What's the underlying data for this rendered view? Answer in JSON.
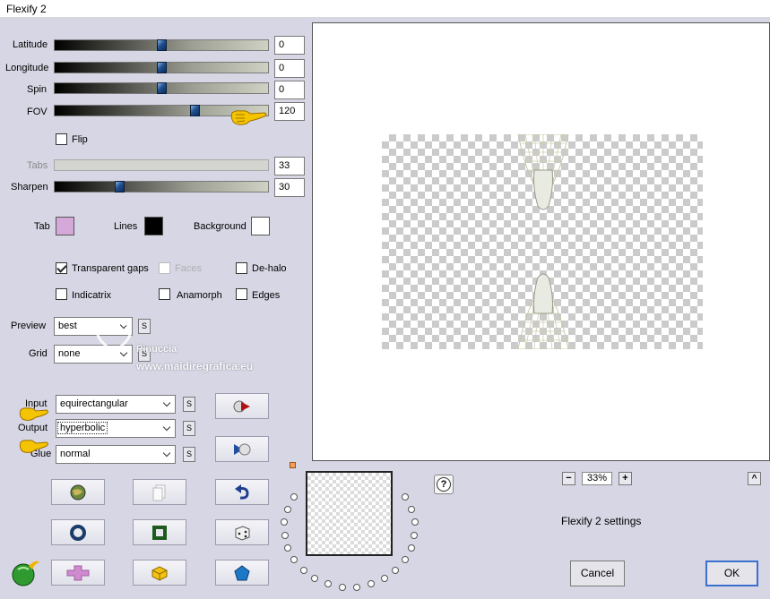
{
  "window": {
    "title": "Flexify 2"
  },
  "sliders": [
    {
      "label": "Latitude",
      "value": "0",
      "position": 0.5
    },
    {
      "label": "Longitude",
      "value": "0",
      "position": 0.5
    },
    {
      "label": "Spin",
      "value": "0",
      "position": 0.5
    },
    {
      "label": "FOV",
      "value": "120",
      "position": 0.67
    }
  ],
  "flip": {
    "label": "Flip",
    "checked": false
  },
  "tabs": {
    "label": "Tabs",
    "value": "33",
    "disabled": true
  },
  "sharpen": {
    "label": "Sharpen",
    "value": "30",
    "position": 0.3
  },
  "colors": {
    "tab_label": "Tab",
    "tab_color": "#d4a8d8",
    "lines_label": "Lines",
    "lines_color": "#000000",
    "background_label": "Background",
    "background_color": "#ffffff"
  },
  "options": {
    "transparent_gaps": "Transparent gaps",
    "faces": "Faces",
    "de_halo": "De-halo",
    "indicatrix": "Indicatrix",
    "anamorph": "Anamorph",
    "edges": "Edges"
  },
  "preview_select": {
    "label": "Preview",
    "value": "best"
  },
  "grid_select": {
    "label": "Grid",
    "value": "none"
  },
  "input_select": {
    "label": "Input",
    "value": "equirectangular"
  },
  "output_select": {
    "label": "Output",
    "value": "hyperbolic"
  },
  "glue_select": {
    "label": "Glue",
    "value": "normal"
  },
  "s_button": "S",
  "zoom": {
    "value": "33%",
    "minus": "−",
    "plus": "+"
  },
  "collapse_button": "^",
  "settings_name": "Flexify 2 settings",
  "help": "?",
  "buttons": {
    "cancel": "Cancel",
    "ok": "OK"
  },
  "watermark": {
    "line1": "Pinuccia",
    "line2": "www.maidiregrafica.eu"
  }
}
